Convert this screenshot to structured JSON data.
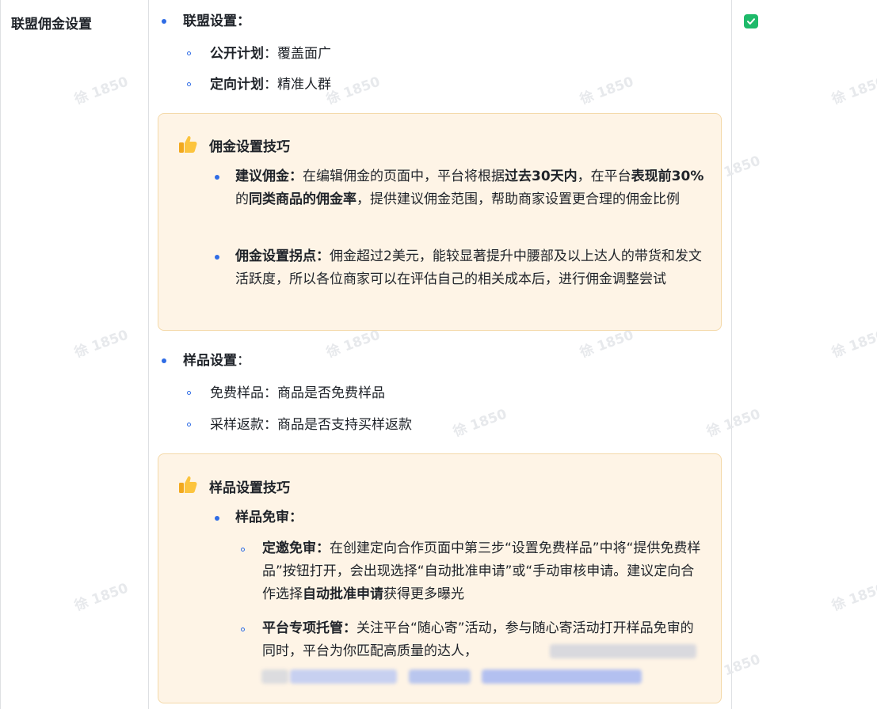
{
  "row": {
    "label": "联盟佣金设置",
    "checked": true
  },
  "alliance": {
    "title": "联盟设置：",
    "items": [
      {
        "bold": "公开计划",
        "rest": "：覆盖面广"
      },
      {
        "bold": "定向计划",
        "rest": "：精准人群"
      }
    ]
  },
  "commission_tips": {
    "title": "佣金设置技巧",
    "icon": "thumbs-up-icon",
    "item1": {
      "label": "建议佣金：",
      "t1": "在编辑佣金的页面中，平台将根据",
      "b1": "过去30天内",
      "t2": "，在平台",
      "b2": "表现前30%",
      "t3": "的",
      "b3": "同类商品的佣金率",
      "t4": "，提供建议佣金范围，帮助商家设置更合理的佣金比例"
    },
    "item2": {
      "label": "佣金设置拐点：",
      "text": "佣金超过2美元，能较显著提升中腰部及以上达人的带货和发文活跃度，所以各位商家可以在评估自己的相关成本后，进行佣金调整尝试"
    }
  },
  "sample": {
    "title": "样品设置",
    "colon": "：",
    "items": [
      {
        "text": "免费样品：商品是否免费样品"
      },
      {
        "text": "采样返款：商品是否支持买样返款"
      }
    ]
  },
  "sample_tips": {
    "title": "样品设置技巧",
    "icon": "thumbs-up-icon",
    "sub_title": "样品免审：",
    "item1": {
      "label": "定邀免审：",
      "t1": "在创建定向合作页面中第三步“设置免费样品”中将“提供免费样品”按钮打开，会出现选择“自动批准申请”或“手动审核申请。建议定向合作选择",
      "b1": "自动批准申请",
      "t2": "获得更多曝光"
    },
    "item2": {
      "label": "平台专项托管：",
      "text": "关注平台“随心寄”活动，参与随心寄活动打开样品免审的同时，平台为你匹配高质量的达人，"
    }
  },
  "watermark": "徐 1850",
  "colors": {
    "accent": "#2f6ce5",
    "callout_bg": "#fef4e6",
    "callout_border": "#f4d9a9",
    "check": "#1eba6a"
  }
}
